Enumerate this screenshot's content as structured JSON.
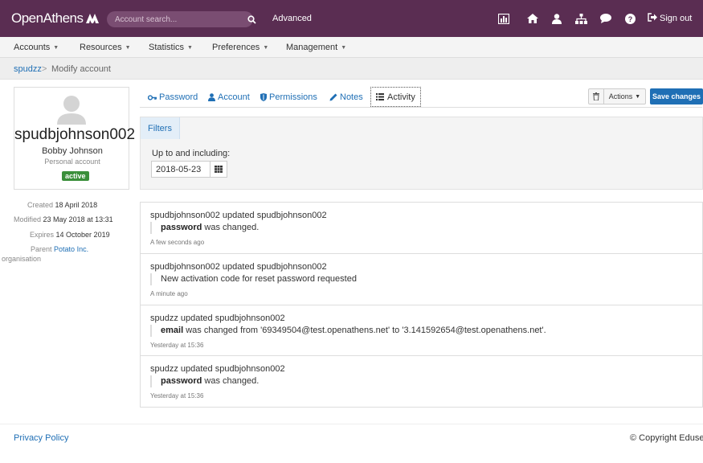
{
  "header": {
    "logo_text": "OpenAthens",
    "search_placeholder": "Account search...",
    "advanced_label": "Advanced",
    "signout_label": "Sign out",
    "icons": [
      "statistics-icon",
      "home-icon",
      "user-icon",
      "sitemap-icon",
      "comment-icon",
      "help-icon",
      "sign-out-icon"
    ]
  },
  "menu": {
    "items": [
      {
        "label": "Accounts"
      },
      {
        "label": "Resources"
      },
      {
        "label": "Statistics"
      },
      {
        "label": "Preferences"
      },
      {
        "label": "Management"
      }
    ]
  },
  "breadcrumb": {
    "link": "spudzz",
    "separator": ">",
    "current": "Modify account"
  },
  "profile": {
    "username": "spudbjohnson002",
    "full_name": "Bobby Johnson",
    "account_type": "Personal account",
    "status": "active"
  },
  "meta": {
    "created_label": "Created",
    "created_value": "18 April 2018",
    "modified_label": "Modified",
    "modified_value": "23 May 2018 at 13:31",
    "expires_label": "Expires",
    "expires_value": "14 October 2019",
    "parent_label": "Parent",
    "parent_label_2": "organisation",
    "parent_value": "Potato Inc."
  },
  "tabs": {
    "password": "Password",
    "account": "Account",
    "permissions": "Permissions",
    "notes": "Notes",
    "activity": "Activity"
  },
  "toolbar": {
    "actions_label": "Actions",
    "save_label": "Save changes"
  },
  "filters": {
    "tab_label": "Filters",
    "date_label": "Up to and including:",
    "date_value": "2018-05-23"
  },
  "activities": [
    {
      "title": "spudbjohnson002 updated spudbjohnson002",
      "detail_bold": "password",
      "detail_rest": " was changed.",
      "time": "A few seconds ago"
    },
    {
      "title": "spudbjohnson002 updated spudbjohnson002",
      "detail_bold": "",
      "detail_rest": "New activation code for reset password requested",
      "time": "A minute ago"
    },
    {
      "title": "spudzz updated spudbjohnson002",
      "detail_bold": "email",
      "detail_rest": " was changed from '69349504@test.openathens.net' to '3.141592654@test.openathens.net'.",
      "time": "Yesterday at 15:36"
    },
    {
      "title": "spudzz updated spudbjohnson002",
      "detail_bold": "password",
      "detail_rest": " was changed.",
      "time": "Yesterday at 15:36"
    }
  ],
  "footer": {
    "privacy": "Privacy Policy",
    "copyright": "© Copyright Eduserv"
  },
  "colors": {
    "header_bg": "#5a2d52",
    "link": "#1f6fb5",
    "active_badge": "#3a8f3a"
  }
}
